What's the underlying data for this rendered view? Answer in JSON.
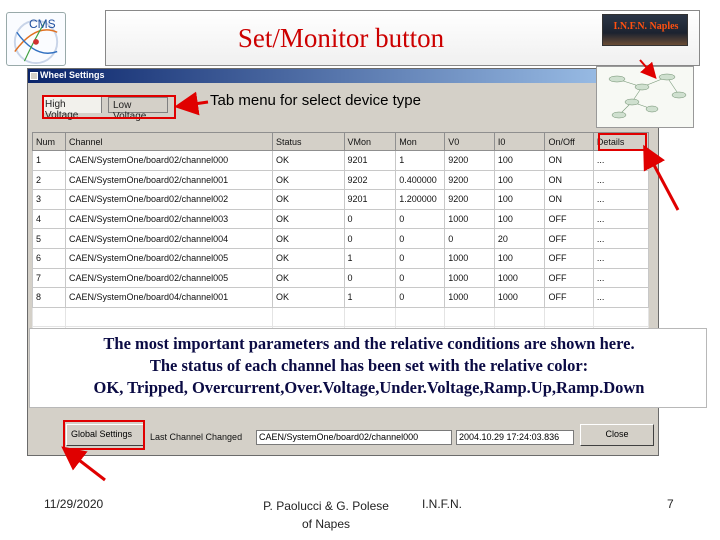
{
  "header": {
    "title": "Set/Monitor button",
    "institute_logo": "I.N.F.N. Naples",
    "cms_logo": "CMS"
  },
  "window": {
    "title": "Wheel Settings",
    "tabs": [
      {
        "label": "High Voltage"
      },
      {
        "label": "Low Voltage"
      }
    ]
  },
  "table": {
    "columns": [
      "Num",
      "Channel",
      "Status",
      "VMon",
      "Mon",
      "V0",
      "I0",
      "On/Off",
      "Details"
    ],
    "rows": [
      [
        "1",
        "CAEN/SystemOne/board02/channel000",
        "OK",
        "9201",
        "1",
        "9200",
        "100",
        "ON",
        "..."
      ],
      [
        "2",
        "CAEN/SystemOne/board02/channel001",
        "OK",
        "9202",
        "0.400000",
        "9200",
        "100",
        "ON",
        "..."
      ],
      [
        "3",
        "CAEN/SystemOne/board02/channel002",
        "OK",
        "9201",
        "1.200000",
        "9200",
        "100",
        "ON",
        "..."
      ],
      [
        "4",
        "CAEN/SystemOne/board02/channel003",
        "OK",
        "0",
        "0",
        "1000",
        "100",
        "OFF",
        "..."
      ],
      [
        "5",
        "CAEN/SystemOne/board02/channel004",
        "OK",
        "0",
        "0",
        "0",
        "20",
        "OFF",
        "..."
      ],
      [
        "6",
        "CAEN/SystemOne/board02/channel005",
        "OK",
        "1",
        "0",
        "1000",
        "100",
        "OFF",
        "..."
      ],
      [
        "7",
        "CAEN/SystemOne/board02/channel005",
        "OK",
        "0",
        "0",
        "1000",
        "1000",
        "OFF",
        "..."
      ],
      [
        "8",
        "CAEN/SystemOne/board04/channel001",
        "OK",
        "1",
        "0",
        "1000",
        "1000",
        "OFF",
        "..."
      ]
    ]
  },
  "bottom": {
    "global_settings_label": "Global Settings",
    "last_changed_label": "Last Channel Changed",
    "last_changed_value": "CAEN/SystemOne/board02/channel000",
    "last_changed_time": "2004.10.29 17:24:03.836",
    "close_label": "Close"
  },
  "annotations": {
    "tab_caption": "Tab menu for select device type",
    "note_line1": "The most important parameters and the relative conditions are shown here.",
    "note_line2": "The status of each channel has been set with the relative color:",
    "note_line3": "OK, Tripped, Overcurrent,Over.Voltage,Under.Voltage,Ramp.Up,Ramp.Down"
  },
  "footer": {
    "date": "11/29/2020",
    "authors_line1": "P. Paolucci & G. Polese",
    "authors_line2": "of Napes",
    "institute": "I.N.F.N.",
    "page": "7"
  },
  "colors": {
    "title": "#cc0000",
    "highlight": "#e00000",
    "note_text": "#0b0b44",
    "window_bg": "#d4d0c8"
  },
  "icons": [
    "cms-logo",
    "infn-naples-logo",
    "diagram-thumbnail",
    "window-system-icon"
  ]
}
